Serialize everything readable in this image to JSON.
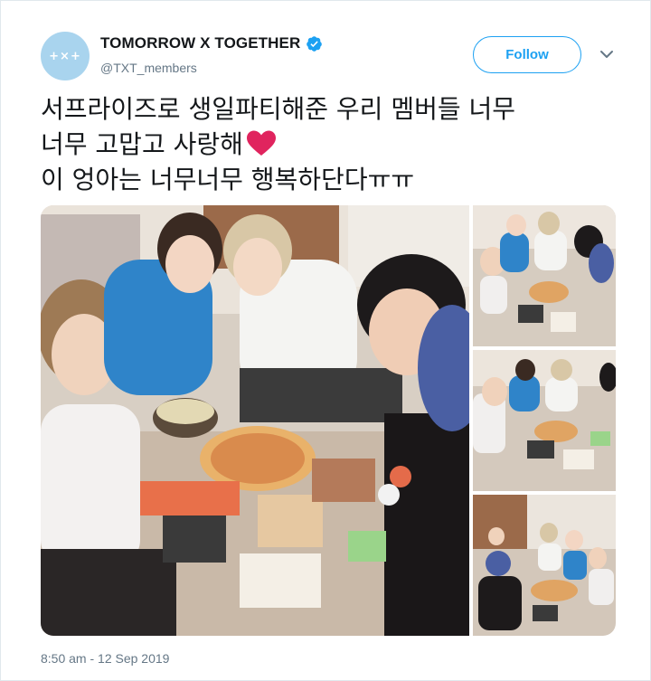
{
  "account": {
    "display_name": "TOMORROW X TOGETHER",
    "handle": "@TXT_members",
    "avatar_logo": "+×+",
    "verified": true,
    "avatar_color": "#a9d4ee"
  },
  "follow_button": {
    "label": "Follow"
  },
  "tweet": {
    "line1": "서프라이즈로 생일파티해준 우리 멤버들 너무",
    "line2": "너무 고맙고 사랑해",
    "line3": "이 엉아는 너무너무 행복하단다ㅠㅠ",
    "emoji": "red-heart"
  },
  "media": {
    "count": 4,
    "items": [
      {
        "id": "main",
        "description_icon": "photo"
      },
      {
        "id": "p1",
        "description_icon": "photo"
      },
      {
        "id": "p2",
        "description_icon": "photo"
      },
      {
        "id": "p3",
        "description_icon": "photo"
      }
    ]
  },
  "timestamp": "8:50 am - 12 Sep 2019",
  "colors": {
    "brand_blue": "#1da1f2",
    "text": "#14171a",
    "secondary_text": "#657786",
    "heart": "#e0245e"
  },
  "icons": {
    "verified": "verified-badge-icon",
    "more": "chevron-down-icon",
    "heart": "heart-icon"
  }
}
